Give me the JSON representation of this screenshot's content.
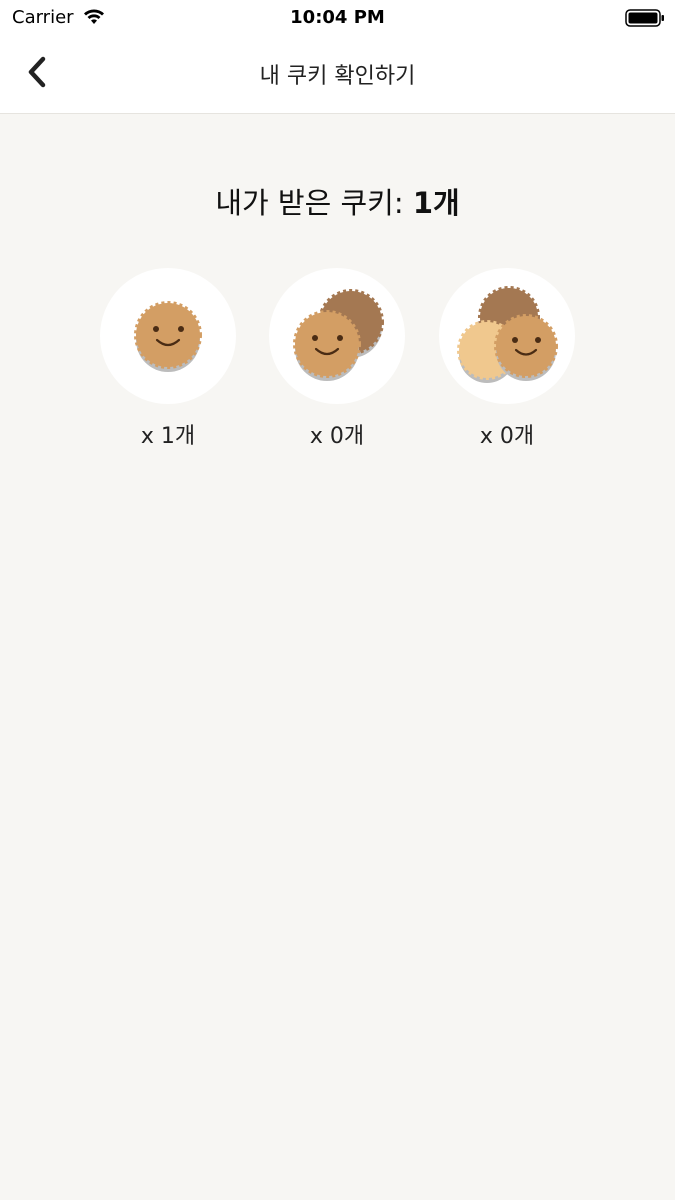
{
  "status_bar": {
    "carrier": "Carrier",
    "time": "10:04 PM",
    "icons": [
      "wifi-icon",
      "battery-icon"
    ]
  },
  "nav": {
    "title": "내 쿠키 확인하기",
    "back_icon": "chevron-left-icon"
  },
  "summary": {
    "label": "내가 받은 쿠키: ",
    "count": "1개"
  },
  "cookies": [
    {
      "icon": "single-cookie-icon",
      "count_label": "x 1개"
    },
    {
      "icon": "double-cookie-icon",
      "count_label": "x 0개"
    },
    {
      "icon": "triple-cookie-icon",
      "count_label": "x 0개"
    }
  ],
  "colors": {
    "background": "#f7f6f3",
    "cookie_main": "#d39e64",
    "cookie_dark": "#a47852",
    "cookie_light": "#f0c88e"
  }
}
